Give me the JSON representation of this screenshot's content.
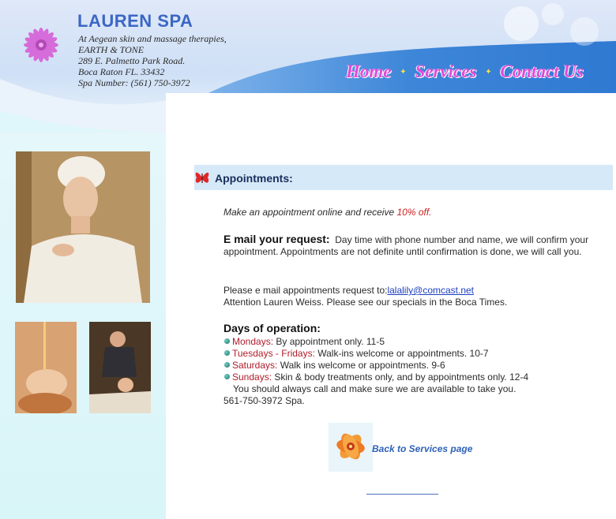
{
  "header": {
    "title": "LAUREN SPA",
    "address_lines": [
      "At Aegean skin and massage therapies,",
      "EARTH & TONE",
      "289 E. Palmetto Park Road.",
      "Boca Raton FL. 33432",
      "Spa Number: (561) 750-3972"
    ]
  },
  "nav": {
    "items": [
      "Home",
      "Services",
      "Contact Us"
    ]
  },
  "section": {
    "title": "Appointments:"
  },
  "content": {
    "intro_prefix": "Make an appointment online and receive ",
    "intro_discount": "10% off.",
    "email_heading": "E mail your request:",
    "email_body": "Day time with phone number and name, we will confirm your appointment.  Appointments are not definite until confirmation is done, we will call you.",
    "email_prompt": "Please e mail appointments request to:",
    "email_address": "lalalily@comcast.net",
    "attention": "Attention Lauren Weiss. Please see our specials in the Boca Times.",
    "days_heading": "Days of operation:",
    "days": [
      {
        "day": "Mondays:",
        "text": " By appointment only. 11-5"
      },
      {
        "day": "Tuesdays - Fridays:",
        "text": " Walk-ins welcome or appointments. 10-7"
      },
      {
        "day": "Saturdays:",
        "text": "  Walk ins welcome or appointments.  9-6"
      },
      {
        "day": "Sundays:",
        "text": " Skin & body treatments only, and by appointments only. 12-4"
      }
    ],
    "call_note": "You should always call and make sure we are available to take you.",
    "phone": "561-750-3972 Spa."
  },
  "back_link": "Back to Services page",
  "colors": {
    "nav": "#e34ad8",
    "title": "#3b67c4",
    "day_labels": "#b01c2a",
    "discount": "#cc1f1f",
    "section_bar": "#d5e9f8",
    "sidebar": "#dff6fa"
  }
}
